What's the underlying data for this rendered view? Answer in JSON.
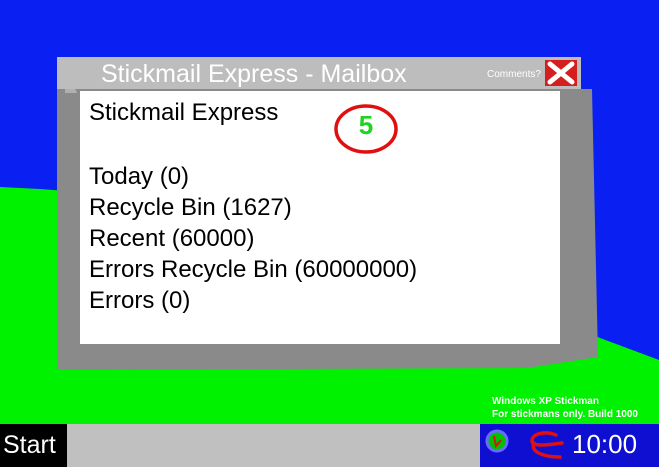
{
  "window": {
    "title": "Stickmail Express - Mailbox",
    "comments_label": "Comments?",
    "app_name": "Stickmail Express",
    "unread_count": "5"
  },
  "folders": [
    "Today (0)",
    "Recycle Bin (1627)",
    "Recent (60000)",
    "Errors Recycle Bin (60000000)",
    "Errors (0)"
  ],
  "watermark": {
    "line1": "Windows XP Stickman",
    "line2": "For stickmans only. Build 1000"
  },
  "taskbar": {
    "start_label": "Start",
    "clock": "10:00"
  },
  "colors": {
    "desktop": "#0a1ff2",
    "hill": "#00f200",
    "window_frame": "#8a8a8a",
    "title_bar": "#bdbdbd",
    "close": "#d51f1f",
    "badge_ring": "#e01010",
    "badge_text": "#1ed41e",
    "taskbar": "#c0c0c0",
    "tray": "#0f0fd2"
  }
}
